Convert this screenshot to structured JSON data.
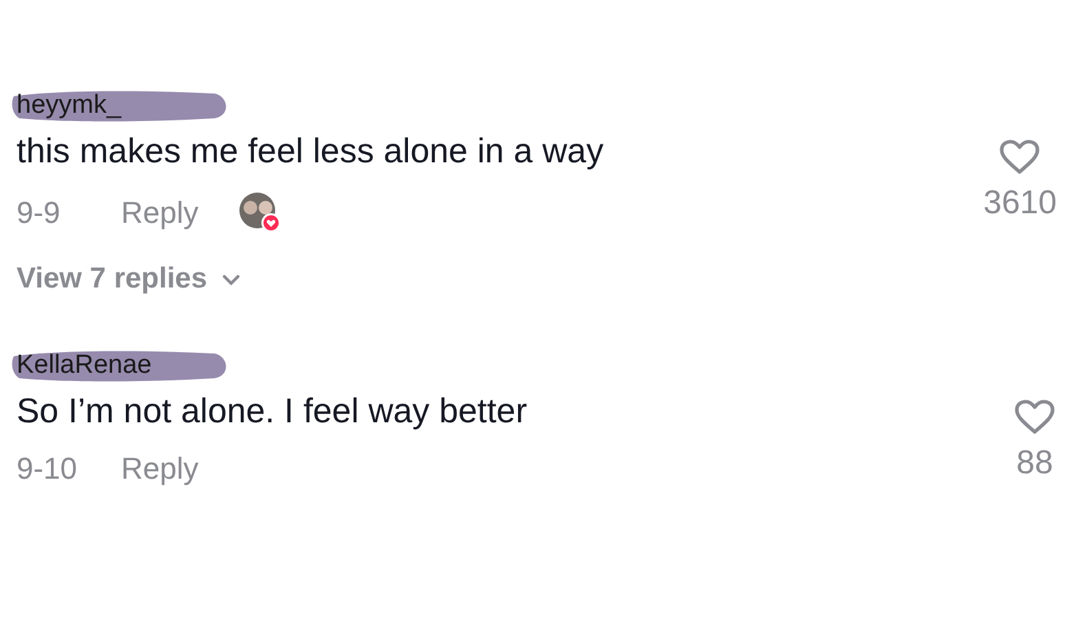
{
  "comments": [
    {
      "username": "heyymk_",
      "text": "this makes me feel less alone in a way",
      "date": "9-9",
      "reply_label": "Reply",
      "creator_liked": true,
      "view_replies": "View 7 replies",
      "likes": "3610",
      "liked": false
    },
    {
      "username": "KellaRenae",
      "text": "So I’m not alone. I feel way better",
      "date": "9-10",
      "reply_label": "Reply",
      "creator_liked": false,
      "likes": "88",
      "liked": false
    }
  ]
}
